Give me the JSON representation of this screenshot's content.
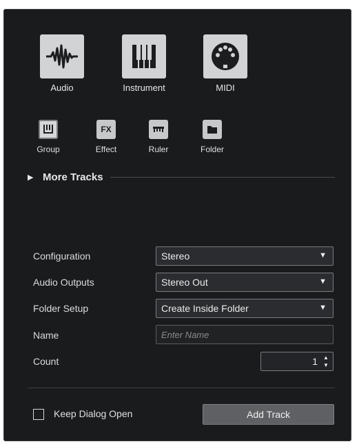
{
  "track_types": {
    "big": [
      {
        "id": "audio",
        "label": "Audio",
        "icon": "audio-waveform-icon"
      },
      {
        "id": "instrument",
        "label": "Instrument",
        "icon": "piano-keys-icon"
      },
      {
        "id": "midi",
        "label": "MIDI",
        "icon": "midi-connector-icon"
      }
    ],
    "small": [
      {
        "id": "group",
        "label": "Group",
        "icon": "group-icon",
        "icon_text": ""
      },
      {
        "id": "effect",
        "label": "Effect",
        "icon": "fx-icon",
        "icon_text": "FX"
      },
      {
        "id": "ruler",
        "label": "Ruler",
        "icon": "ruler-icon",
        "icon_text": ""
      },
      {
        "id": "folder",
        "label": "Folder",
        "icon": "folder-icon",
        "icon_text": ""
      }
    ]
  },
  "more_tracks": {
    "arrow": "▶",
    "label": "More Tracks"
  },
  "fields": {
    "configuration": {
      "label": "Configuration",
      "value": "Stereo"
    },
    "audio_outputs": {
      "label": "Audio Outputs",
      "value": "Stereo Out"
    },
    "folder_setup": {
      "label": "Folder Setup",
      "value": "Create Inside Folder"
    },
    "name": {
      "label": "Name",
      "value": "",
      "placeholder": "Enter Name"
    },
    "count": {
      "label": "Count",
      "value": "1"
    }
  },
  "caret": "▼",
  "spinner": {
    "up": "▲",
    "down": "▼"
  },
  "footer": {
    "keep_dialog_open": {
      "label": "Keep Dialog Open",
      "checked": false
    },
    "add_track_label": "Add Track"
  },
  "colors": {
    "background": "#1a1b1d",
    "tile": "#d1d3d5",
    "field_border": "#7a7b7e",
    "button": "#5f6063"
  }
}
